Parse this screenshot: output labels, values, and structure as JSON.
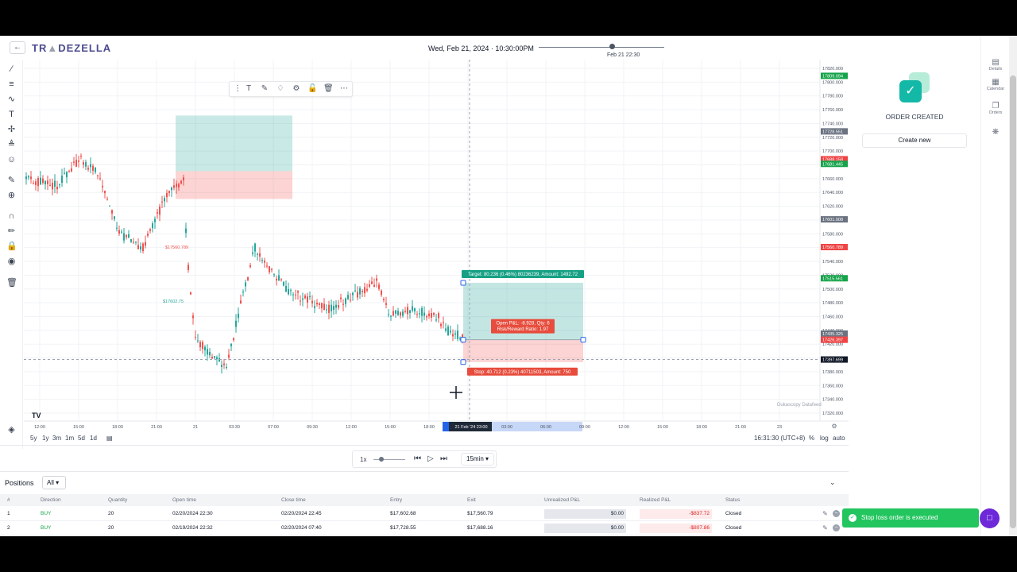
{
  "header": {
    "back_icon": "arrow-left-icon",
    "logo_a": "TR",
    "logo_b": "DEZELLA",
    "datetime": "Wed, Feb 21, 2024  ·  10:30:00PM",
    "slider_label": "Feb 21 22:30"
  },
  "chart": {
    "price_axis": [
      "17820.000",
      "17800.000",
      "17780.000",
      "17760.000",
      "17740.000",
      "17720.000",
      "17700.000",
      "17680.000",
      "17660.000",
      "17640.000",
      "17620.000",
      "17600.000",
      "17580.000",
      "17560.000",
      "17540.000",
      "17520.000",
      "17500.000",
      "17480.000",
      "17460.000",
      "17440.000",
      "17420.000",
      "17400.000",
      "17380.000",
      "17360.000",
      "17340.000",
      "17320.000"
    ],
    "price_badges": [
      {
        "value": "17809.094",
        "color": "#16a34a",
        "price": 17809.094
      },
      {
        "value": "17728.551",
        "color": "#6b7280",
        "price": 17728.551
      },
      {
        "value": "17688.158",
        "color": "#ef4444",
        "price": 17688.158
      },
      {
        "value": "17681.445",
        "color": "#16a34a",
        "price": 17681.445
      },
      {
        "value": "17601.008",
        "color": "#6b7280",
        "price": 17601.008
      },
      {
        "value": "17560.789",
        "color": "#ef4444",
        "price": 17560.789
      },
      {
        "value": "17515.561",
        "color": "#16a34a",
        "price": 17515.561
      },
      {
        "value": "17435.325",
        "color": "#6b7280",
        "price": 17435.325
      },
      {
        "value": "17426.397",
        "color": "#ef4444",
        "price": 17426.397
      },
      {
        "value": "17397.699",
        "color": "#111827",
        "price": 17397.699
      }
    ],
    "time_axis": [
      "12:00",
      "15:00",
      "18:00",
      "21:00",
      "21",
      "03:30",
      "07:00",
      "09:30",
      "12:00",
      "15:00",
      "18:00",
      "",
      "03:00",
      "06:00",
      "09:00",
      "12:00",
      "15:00",
      "18:00",
      "21:00",
      "23"
    ],
    "time_cursor_label": "21 Feb '24   23:00",
    "target_label": "Target: 80.236 (0.46%) 80236239, Amount: 1492.72",
    "stop_label": "Stop: 40.712 (0.23%) 40711503, Amount: 750",
    "open_pnl_label": "Open P&L: -8.928, Qty: 6",
    "rr_label": "Risk/Reward Ratio: 1.97",
    "old_exit_label": "$17560.789",
    "old_entry_label": "$17602.75",
    "watermark": "Dukascopy Datafeed",
    "tv_logo": "TV",
    "colors": {
      "up": "#26a69a",
      "down": "#ef5350",
      "target_zone": "#26a69a",
      "stop_zone": "#ef5350"
    }
  },
  "timeframes": [
    "5y",
    "1y",
    "3m",
    "1m",
    "5d",
    "1d"
  ],
  "timezone": "16:31:30 (UTC+8)",
  "scale_opts": [
    "%",
    "log",
    "auto"
  ],
  "replay": {
    "speed": "1x",
    "interval": "15min"
  },
  "positions": {
    "title": "Positions",
    "filter": "All",
    "columns": [
      "#",
      "Direction",
      "Quantity",
      "Open time",
      "Close time",
      "Entry",
      "Exit",
      "Unrealized P&L",
      "Realized P&L",
      "Status"
    ],
    "rows": [
      {
        "n": "1",
        "dir": "BUY",
        "qty": "20",
        "open": "02/20/2024 22:30",
        "close": "02/20/2024 22:45",
        "entry": "$17,602.68",
        "exit": "$17,560.79",
        "unreal": "$0.00",
        "real": "-$837.72",
        "status": "Closed"
      },
      {
        "n": "2",
        "dir": "BUY",
        "qty": "20",
        "open": "02/19/2024 22:32",
        "close": "02/20/2024 07:40",
        "entry": "$17,728.55",
        "exit": "$17,688.16",
        "unreal": "$0.00",
        "real": "-$807.86",
        "status": "Closed"
      }
    ]
  },
  "right_panel": {
    "order_created": "ORDER CREATED",
    "create_new": "Create new",
    "rail": [
      {
        "label": "Details",
        "icon": "details-icon"
      },
      {
        "label": "Calendar",
        "icon": "calendar-icon"
      },
      {
        "label": "Orders",
        "icon": "orders-icon"
      },
      {
        "label": "",
        "icon": "bug-icon"
      }
    ]
  },
  "toast": {
    "message": "Stop loss order is executed"
  }
}
